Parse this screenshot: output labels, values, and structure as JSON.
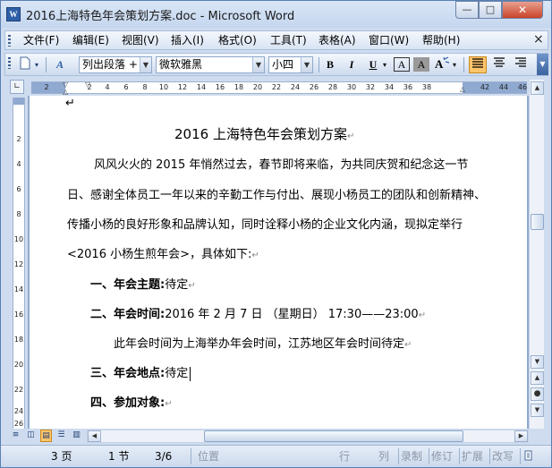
{
  "window": {
    "title": "2016上海特色年会策划方案.doc - Microsoft Word",
    "app_icon_label": "W",
    "minimize": "—",
    "maximize": "□",
    "close": "✕"
  },
  "menu": {
    "items": [
      "文件(F)",
      "编辑(E)",
      "视图(V)",
      "插入(I)",
      "格式(O)",
      "工具(T)",
      "表格(A)",
      "窗口(W)",
      "帮助(H)"
    ],
    "close_doc": "×"
  },
  "toolbar": {
    "style_value": "列出段落 +",
    "font_value": "微软雅黑",
    "size_value": "小四",
    "bold": "B",
    "italic": "I",
    "underline": "U",
    "char_border": "A",
    "char_shading": "A"
  },
  "ruler": {
    "horizontal_ticks": [
      "2",
      "2",
      "4",
      "6",
      "8",
      "10",
      "12",
      "14",
      "16",
      "18",
      "20",
      "22",
      "24",
      "26",
      "28",
      "30",
      "32",
      "34",
      "36",
      "38",
      "42",
      "44",
      "46"
    ],
    "vertical_ticks": [
      "2",
      "4",
      "6",
      "8",
      "10",
      "12",
      "14",
      "16",
      "18",
      "20",
      "22",
      "24",
      "26"
    ]
  },
  "document": {
    "title": "2016 上海特色年会策划方案",
    "para1_line1": "风风火火的 2015 年悄然过去，春节即将来临，为共同庆贺和纪念这一节",
    "para1_line2": "日、感谢全体员工一年以来的辛勤工作与付出、展现小杨员工的团队和创新精神、",
    "para1_line3": "传播小杨的良好形象和品牌认知，同时诠释小杨的企业文化内涵，现拟定举行",
    "para1_line4": "<2016 小杨生煎年会>，具体如下:",
    "item1_label": "一、年会主题:",
    "item1_value": "待定",
    "item2_label": "二、年会时间:",
    "item2_value": "2016 年 2 月 7 日 （星期日） 17:30——23:00",
    "item2_note": "此年会时间为上海举办年会时间，江苏地区年会时间待定",
    "item3_label": "三、年会地点:",
    "item3_value": "待定",
    "item4_label": "四、参加对象:",
    "para_mark": "↵"
  },
  "statusbar": {
    "page": "3 页",
    "section": "1 节",
    "page_of": "3/6",
    "position": "位置",
    "line": "行",
    "column": "列",
    "record": "录制",
    "revise": "修订",
    "extend": "扩展",
    "overwrite": "改写"
  }
}
